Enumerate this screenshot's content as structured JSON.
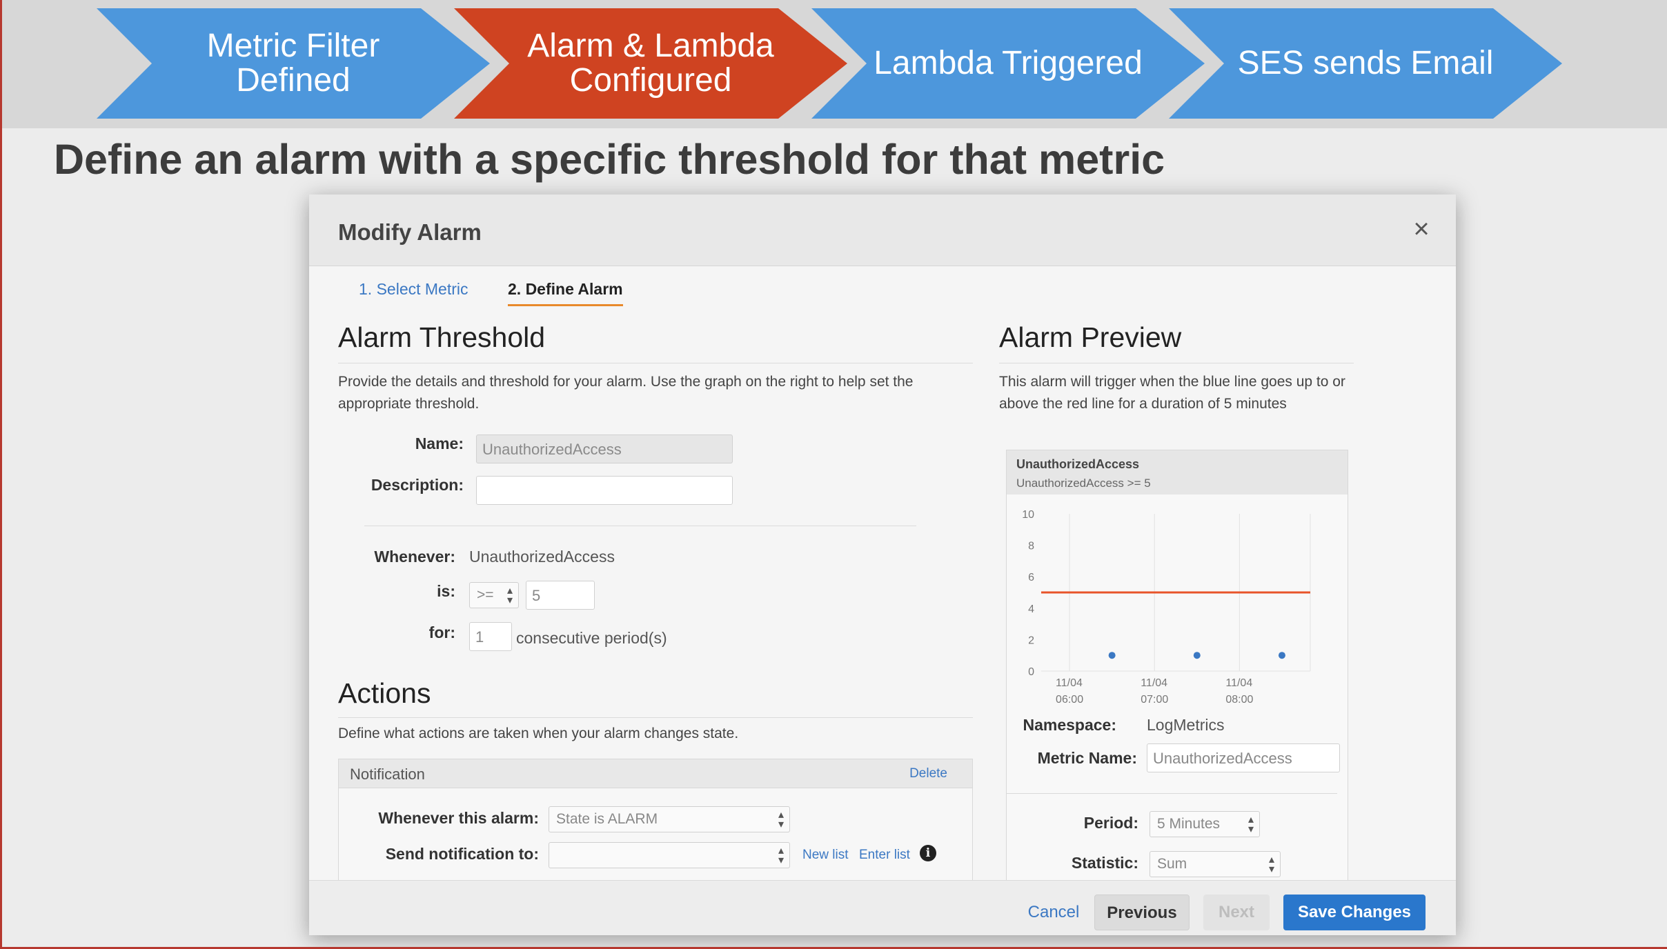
{
  "process": {
    "steps": [
      {
        "label": "Metric Filter\nDefined",
        "color": "#4d97dc"
      },
      {
        "label": "Alarm & Lambda\nConfigured",
        "color": "#cf4321"
      },
      {
        "label": "Lambda Triggered",
        "color": "#4d97dc"
      },
      {
        "label": "SES sends Email",
        "color": "#4d97dc"
      }
    ]
  },
  "slide_title": "Define an alarm with a specific threshold for that metric",
  "modal": {
    "title": "Modify Alarm",
    "close_symbol": "×",
    "steps": [
      {
        "label": "1. Select Metric",
        "active": false
      },
      {
        "label": "2. Define Alarm",
        "active": true
      }
    ],
    "threshold": {
      "heading": "Alarm Threshold",
      "description": "Provide the details and threshold for your alarm. Use the graph on the right to help set the appropriate threshold.",
      "name_label": "Name:",
      "name_value": "UnauthorizedAccess",
      "description_label": "Description:",
      "description_value": "",
      "whenever_label": "Whenever:",
      "whenever_value": "UnauthorizedAccess",
      "is_label": "is:",
      "operator": ">=",
      "threshold_value": "5",
      "for_label": "for:",
      "periods_value": "1",
      "periods_suffix": "consecutive period(s)"
    },
    "actions": {
      "heading": "Actions",
      "description": "Define what actions are taken when your alarm changes state.",
      "notification_title": "Notification",
      "delete_label": "Delete",
      "whenever_alarm_label": "Whenever this alarm:",
      "state_value": "State is ALARM",
      "send_to_label": "Send notification to:",
      "send_to_value": "",
      "new_list_label": "New list",
      "enter_list_label": "Enter list",
      "info_symbol": "i"
    },
    "preview": {
      "heading": "Alarm Preview",
      "description": "This alarm will trigger when the blue line goes up to or above the red line for a duration of 5 minutes",
      "chart_title": "UnauthorizedAccess",
      "chart_subtitle": "UnauthorizedAccess >= 5",
      "namespace_label": "Namespace:",
      "namespace_value": "LogMetrics",
      "metric_name_label": "Metric Name:",
      "metric_name_value": "UnauthorizedAccess",
      "period_label": "Period:",
      "period_value": "5 Minutes",
      "statistic_label": "Statistic:",
      "statistic_value": "Sum"
    },
    "footer": {
      "cancel": "Cancel",
      "previous": "Previous",
      "next": "Next",
      "save": "Save Changes"
    }
  },
  "chart_data": {
    "type": "line",
    "title": "UnauthorizedAccess",
    "subtitle": "UnauthorizedAccess >= 5",
    "ylim": [
      0,
      10
    ],
    "yticks": [
      "10",
      "8",
      "6",
      "4",
      "2",
      "0"
    ],
    "xticks": [
      {
        "date": "11/04",
        "time": "06:00"
      },
      {
        "date": "11/04",
        "time": "07:00"
      },
      {
        "date": "11/04",
        "time": "08:00"
      }
    ],
    "threshold": 5,
    "threshold_color": "#e8542a",
    "series_color": "#3b78c3",
    "points": [
      {
        "x": "06:30",
        "y": 1
      },
      {
        "x": "07:30",
        "y": 1
      },
      {
        "x": "08:30",
        "y": 1
      }
    ]
  }
}
